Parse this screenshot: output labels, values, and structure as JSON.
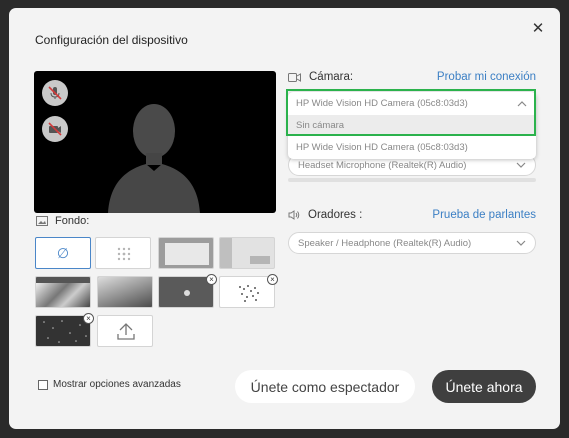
{
  "dialog": {
    "title": "Configuración del dispositivo",
    "close_icon": "close-icon"
  },
  "preview": {
    "mic_icon": "mic-muted-icon",
    "camera_icon": "camera-off-icon"
  },
  "background": {
    "label": "Fondo:",
    "none_symbol": "∅",
    "upload_icon": "upload-icon",
    "tiles": [
      "none",
      "blur",
      "room-white",
      "office-white",
      "city-bw",
      "road-bw",
      "logo-gray",
      "world-map",
      "starfield",
      "upload"
    ]
  },
  "camera": {
    "label": "Cámara:",
    "test_link": "Probar mi conexión",
    "selected": "HP Wide Vision HD Camera (05c8:03d3)",
    "options": [
      "Sin cámara",
      "HP Wide Vision HD Camera (05c8:03d3)"
    ],
    "highlight_color": "#2bb24c"
  },
  "microphone": {
    "selected": "Headset Microphone (Realtek(R) Audio)"
  },
  "speakers": {
    "label": "Oradores :",
    "test_link": "Prueba de parlantes",
    "selected": "Speaker / Headphone (Realtek(R) Audio)"
  },
  "footer": {
    "advanced_label": "Mostrar opciones avanzadas",
    "viewer_button": "Únete como espectador",
    "join_button": "Únete ahora"
  },
  "colors": {
    "accent": "#3b7fc4",
    "join_bg": "#3f3f3f",
    "dialog_bg": "#f3f3f3"
  }
}
